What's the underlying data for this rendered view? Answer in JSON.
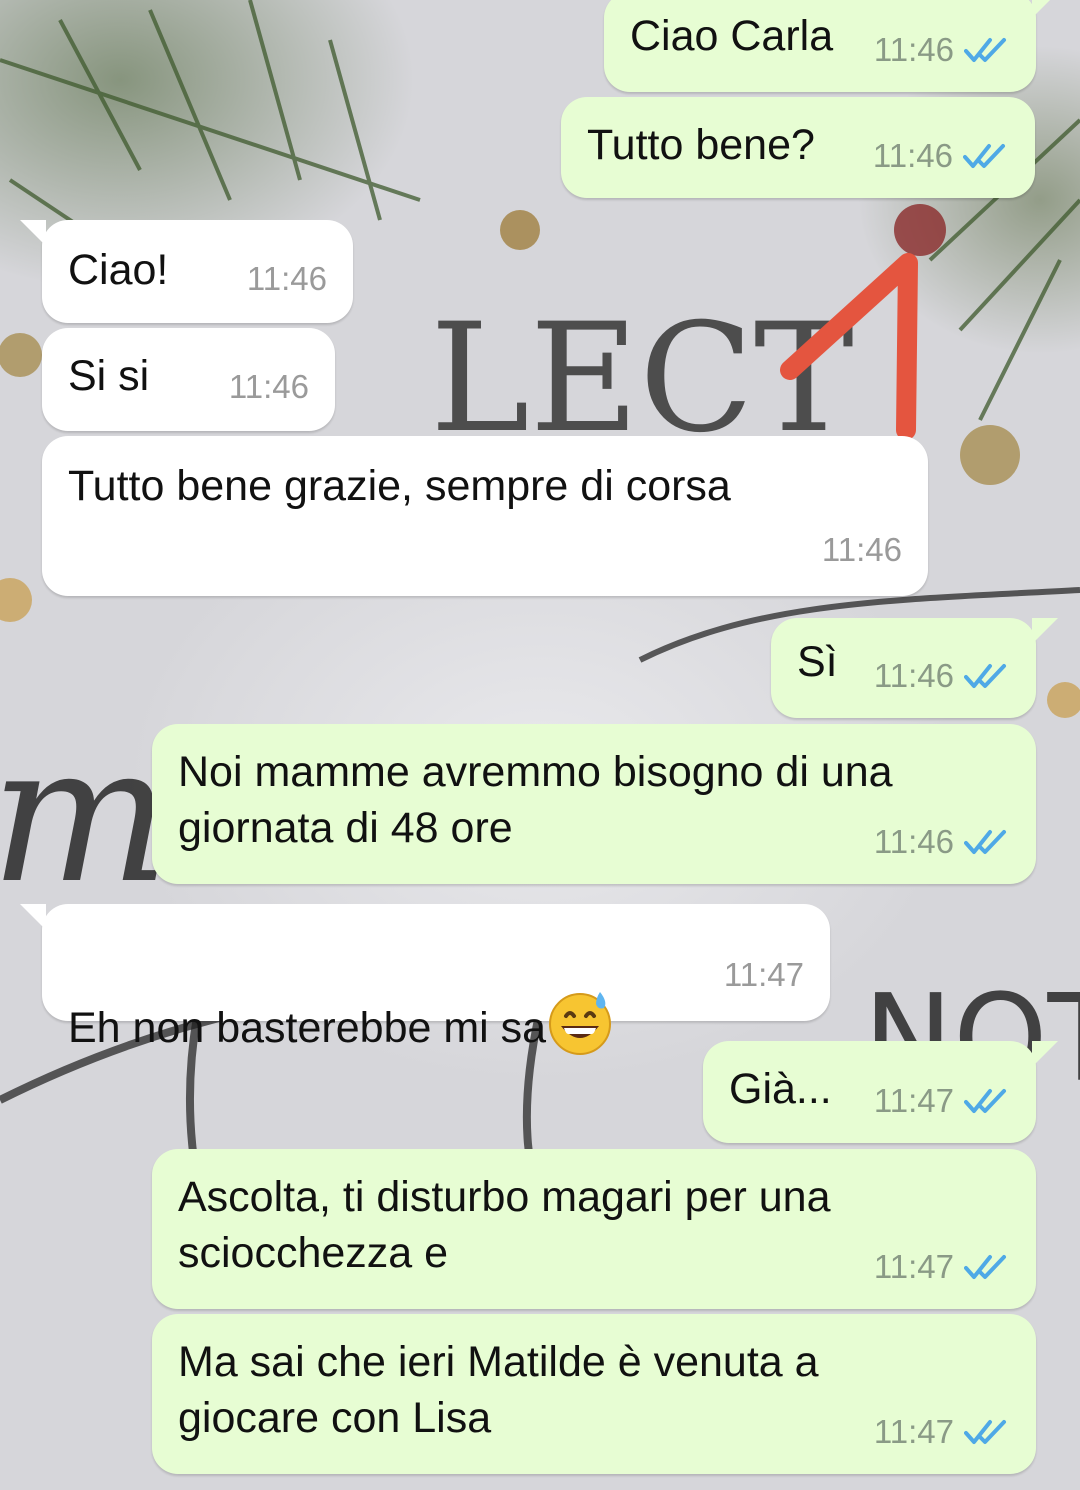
{
  "colors": {
    "outgoing_bubble": "#e7fdd3",
    "incoming_bubble": "#ffffff",
    "read_ticks": "#4fa9e6",
    "annotation_arrow": "#e4553f"
  },
  "wallpaper": {
    "text_fragments": [
      "LECT",
      "m",
      "-NOT-"
    ]
  },
  "messages": [
    {
      "direction": "out",
      "text": "Ciao Carla",
      "time": "11:46",
      "status": "read"
    },
    {
      "direction": "out",
      "text": "Tutto bene?",
      "time": "11:46",
      "status": "read"
    },
    {
      "direction": "in",
      "text": "Ciao!",
      "time": "11:46"
    },
    {
      "direction": "in",
      "text": "Si si",
      "time": "11:46"
    },
    {
      "direction": "in",
      "text": "Tutto bene grazie, sempre di corsa",
      "time": "11:46"
    },
    {
      "direction": "out",
      "text": "Sì",
      "time": "11:46",
      "status": "read"
    },
    {
      "direction": "out",
      "text": "Noi mamme avremmo bisogno di una\ngiornata di 48 ore",
      "time": "11:46",
      "status": "read"
    },
    {
      "direction": "in",
      "text": "Eh non basterebbe mi sa",
      "emoji": "grinning-face-with-sweat",
      "time": "11:47"
    },
    {
      "direction": "out",
      "text": "Già...",
      "time": "11:47",
      "status": "read"
    },
    {
      "direction": "out",
      "text": "Ascolta, ti disturbo magari per una\nsciocchezza e",
      "time": "11:47",
      "status": "read"
    },
    {
      "direction": "out",
      "text": "Ma sai che ieri Matilde è venuta a\ngiocare con Lisa",
      "time": "11:47",
      "status": "read"
    }
  ]
}
